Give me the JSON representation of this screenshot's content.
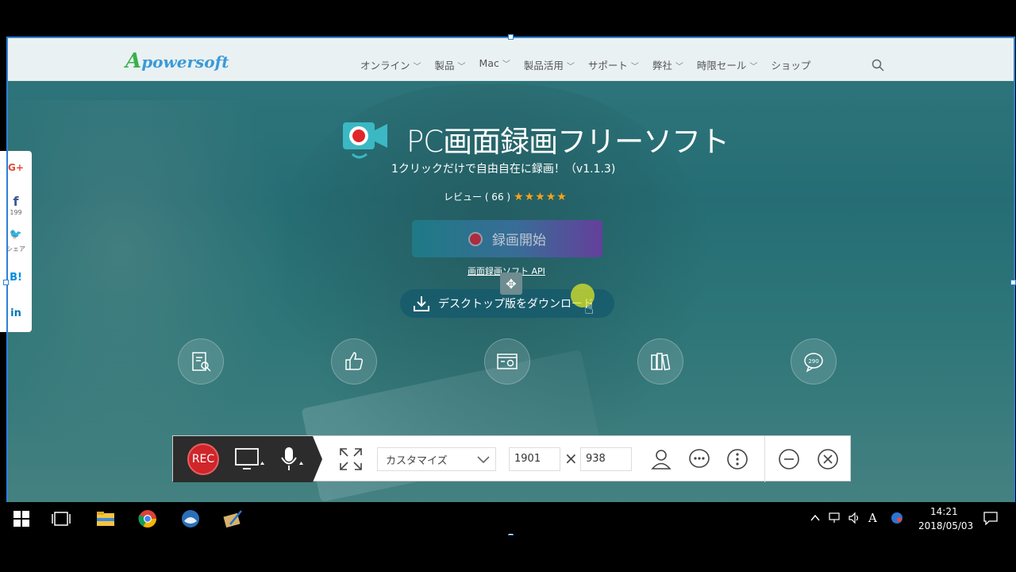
{
  "site": {
    "logo": {
      "mark": "A",
      "text": "powersoft"
    },
    "nav": [
      {
        "label": "オンライン",
        "has_dropdown": true
      },
      {
        "label": "製品",
        "has_dropdown": true
      },
      {
        "label": "Mac",
        "has_dropdown": true
      },
      {
        "label": "製品活用",
        "has_dropdown": true
      },
      {
        "label": "サポート",
        "has_dropdown": true
      },
      {
        "label": "弊社",
        "has_dropdown": true
      },
      {
        "label": "時限セール",
        "has_dropdown": true
      },
      {
        "label": "ショップ",
        "has_dropdown": false
      }
    ],
    "hero": {
      "title": "PC画面録画フリーソフト",
      "subtitle": "1クリックだけで自由自在に録画！（v1.1.3)",
      "rating_label": "レビュー ( 66 )",
      "rating_value": 4.5,
      "rating_stars": "★★★★★",
      "start_button": "録画開始",
      "api_link": "画面録画ソフト API",
      "download_button": "デスクトップ版をダウンロード"
    },
    "feature_icons": [
      "search-doc-icon",
      "thumbs-up-icon",
      "screenshot-icon",
      "books-icon",
      "comments-icon"
    ],
    "comments_count": "290",
    "social": [
      {
        "icon": "google-plus-icon",
        "label": "G+",
        "count": ""
      },
      {
        "icon": "facebook-icon",
        "label": "f",
        "count": "199"
      },
      {
        "icon": "twitter-icon",
        "label": "🐦",
        "count": "シェア"
      },
      {
        "icon": "hatena-icon",
        "label": "B!",
        "count": ""
      },
      {
        "icon": "linkedin-icon",
        "label": "in",
        "count": ""
      }
    ]
  },
  "recorder": {
    "rec_label": "REC",
    "preset": "カスタマイズ",
    "width": "1901",
    "times": "×",
    "height": "938"
  },
  "taskbar": {
    "time": "14:21",
    "date": "2018/05/03",
    "ime": "A"
  },
  "colors": {
    "brand_blue": "#3a9ad9",
    "rec_red": "#d0252a",
    "star": "#f7a21b"
  }
}
